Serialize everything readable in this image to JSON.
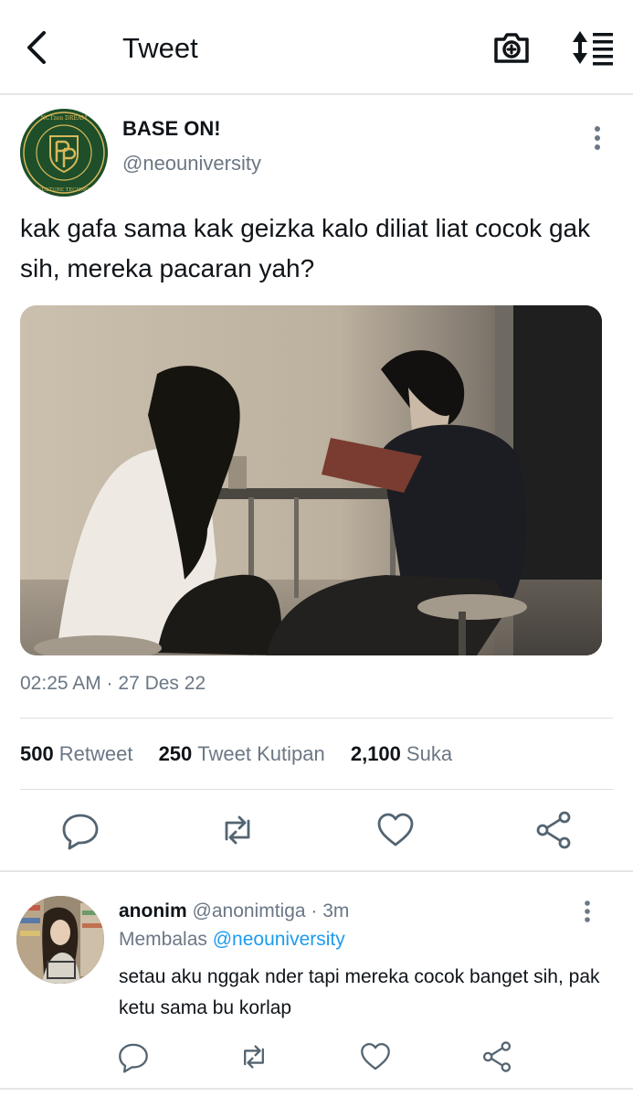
{
  "header": {
    "title": "Tweet",
    "back_icon": "back-arrow-icon",
    "camera_icon": "camera-plus-icon",
    "sort_icon": "sort-list-icon"
  },
  "tweet": {
    "author_name": "BASE ON!",
    "author_handle": "@neouniversity",
    "avatar_ring_text": "NCTzen DREAM · NEO CULTURE TECHNOLOGY",
    "text": "kak gafa sama kak geizka kalo diliat liat cocok gak sih, mereka pacaran yah?",
    "timestamp": "02:25 AM · 27 Des 22",
    "stats": {
      "retweets": "500",
      "retweets_label": "Retweet",
      "quotes": "250",
      "quotes_label": "Tweet Kutipan",
      "likes": "2,100",
      "likes_label": "Suka"
    }
  },
  "reply": {
    "name": "anonim",
    "handle": "@anonimtiga",
    "time": "· 3m",
    "replying_prefix": "Membalas",
    "replying_to": "@neouniversity",
    "text": "setau aku nggak nder tapi mereka cocok banget sih, pak ketu sama bu korlap"
  },
  "colors": {
    "text_primary": "#0f1419",
    "text_secondary": "#6b7785",
    "link": "#1d9bf0",
    "divider": "#dcdfe3",
    "avatar_green": "#1e4f2a",
    "avatar_gold": "#d7b85a"
  }
}
